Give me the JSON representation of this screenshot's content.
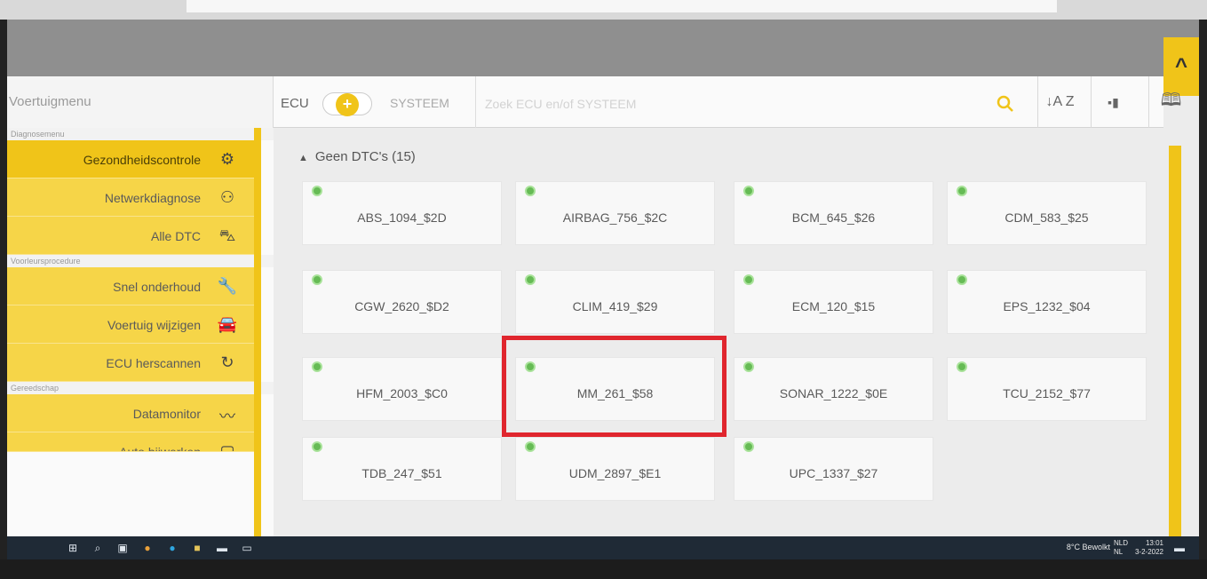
{
  "header": {
    "menu_label": "Voertuigmenu",
    "ecu_label": "ECU",
    "toggle_symbol": "+",
    "systeem_label": "SYSTEEM",
    "search_placeholder": "Zoek ECU en/of SYSTEEM",
    "collapse_symbol": "^",
    "sort_icon_glyph": "↓A Z",
    "signal_icon_glyph": "▪▮",
    "book_icon_glyph": "🕮"
  },
  "sidebar": {
    "sections": [
      {
        "title": "Diagnosemenu",
        "items": [
          {
            "label": "Gezondheidscontrole",
            "icon": "gear-icon",
            "glyph": "⚙",
            "active": true
          },
          {
            "label": "Netwerkdiagnose",
            "icon": "network-icon",
            "glyph": "⚇"
          },
          {
            "label": "Alle DTC",
            "icon": "car-search-icon",
            "glyph": "⛍"
          }
        ]
      },
      {
        "title": "Voorleursprocedure",
        "items": [
          {
            "label": "Snel onderhoud",
            "icon": "wrench-icon",
            "glyph": "🔧"
          },
          {
            "label": "Voertuig wijzigen",
            "icon": "car-icon",
            "glyph": "🚘"
          },
          {
            "label": "ECU herscannen",
            "icon": "refresh-icon",
            "glyph": "↻"
          }
        ]
      },
      {
        "title": "Gereedschap",
        "items": [
          {
            "label": "Datamonitor",
            "icon": "graph-icon",
            "glyph": "〰"
          },
          {
            "label": "Auto bijwerken",
            "icon": "update-icon",
            "glyph": "▢"
          }
        ]
      }
    ]
  },
  "main": {
    "group_title": "Geen DTC's (15)",
    "tiles": [
      {
        "label": "ABS_1094_$2D"
      },
      {
        "label": "AIRBAG_756_$2C"
      },
      {
        "label": "BCM_645_$26"
      },
      {
        "label": "CDM_583_$25"
      },
      {
        "label": "CGW_2620_$D2"
      },
      {
        "label": "CLIM_419_$29"
      },
      {
        "label": "ECM_120_$15"
      },
      {
        "label": "EPS_1232_$04"
      },
      {
        "label": "HFM_2003_$C0"
      },
      {
        "label": "MM_261_$58"
      },
      {
        "label": "SONAR_1222_$0E"
      },
      {
        "label": "TCU_2152_$77"
      },
      {
        "label": "TDB_247_$51"
      },
      {
        "label": "UDM_2897_$E1"
      },
      {
        "label": "UPC_1337_$27"
      }
    ]
  },
  "taskbar": {
    "weather": "8°C Bewolkt",
    "lang": "NLD",
    "lang_sub": "NL",
    "time": "13:01",
    "date": "3-2-2022"
  },
  "colors": {
    "accent": "#f0c419",
    "highlight": "#e0262e",
    "status_ok": "#66bb55"
  }
}
